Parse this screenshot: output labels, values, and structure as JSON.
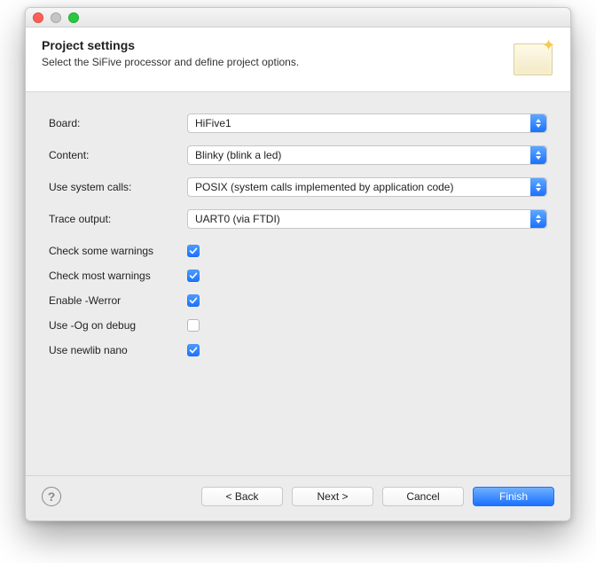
{
  "header": {
    "title": "Project settings",
    "subtitle": "Select the SiFive processor and define project options."
  },
  "fields": {
    "board_label": "Board:",
    "board_value": "HiFive1",
    "content_label": "Content:",
    "content_value": "Blinky (blink a led)",
    "syscalls_label": "Use system calls:",
    "syscalls_value": "POSIX (system calls implemented by application code)",
    "trace_label": "Trace output:",
    "trace_value": "UART0 (via FTDI)"
  },
  "checkboxes": {
    "check_some_label": "Check some warnings",
    "check_some_checked": true,
    "check_most_label": "Check most warnings",
    "check_most_checked": true,
    "werror_label": "Enable -Werror",
    "werror_checked": true,
    "og_label": "Use -Og on debug",
    "og_checked": false,
    "newlib_label": "Use newlib nano",
    "newlib_checked": true
  },
  "buttons": {
    "back": "< Back",
    "next": "Next >",
    "cancel": "Cancel",
    "finish": "Finish"
  }
}
